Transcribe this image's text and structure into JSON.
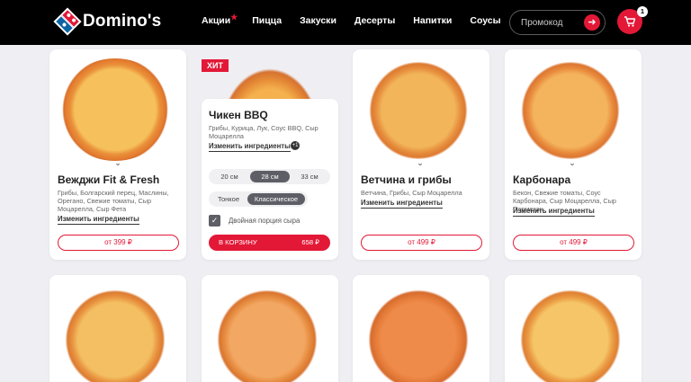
{
  "brand": {
    "name": "Domino's"
  },
  "nav": {
    "items": [
      "Акции",
      "Пицца",
      "Закуски",
      "Десерты",
      "Напитки",
      "Соусы"
    ]
  },
  "promo": {
    "placeholder": "Промокод",
    "go_icon": "arrow-right-icon"
  },
  "cart": {
    "count": "1",
    "icon": "cart-icon"
  },
  "hit_label": "ХИТ",
  "change_label": "Изменить ингредиенты",
  "cards": [
    {
      "title": "Вежджи Fit & Fresh",
      "desc": "Грибы, Болгарский перец, Маслины, Орегано, Свежие томаты, Сыр Моцарелла, Сыр Фета",
      "price": "от 399 ₽"
    },
    {
      "title": "Чикен BBQ",
      "desc": "Грибы, Курица, Лук, Соус BBQ, Сыр Моцарелла",
      "price": "658 ₽"
    },
    {
      "title": "Ветчина и грибы",
      "desc": "Ветчина, Грибы, Сыр Моцарелла",
      "price": "от 499 ₽"
    },
    {
      "title": "Карбонара",
      "desc": "Бекон, Свежие томаты, Соус Карбонара, Сыр Моцарелла, Сыр Пармезан",
      "price": "от 499 ₽"
    }
  ],
  "expanded": {
    "plus_badge": "+1",
    "sizes": [
      "20 см",
      "28 см",
      "33 см"
    ],
    "selected_size": "28 см",
    "crusts": [
      "Тонкое",
      "Классическое"
    ],
    "selected_crust": "Классическое",
    "double_cheese_label": "Двойная порция сыра",
    "double_cheese_checked": true,
    "add_label": "В КОРЗИНУ",
    "add_price": "658 ₽"
  },
  "colors": {
    "accent": "#e31837",
    "brand_blue": "#0b64a3",
    "header_bg": "#000000",
    "page_bg": "#efeef3"
  }
}
